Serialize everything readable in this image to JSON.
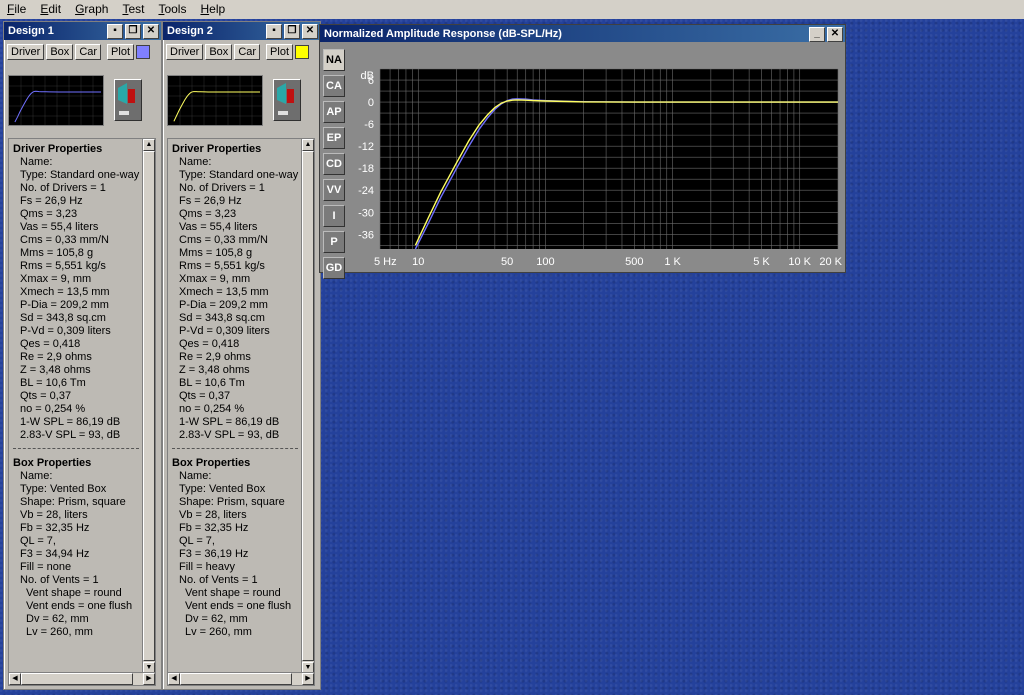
{
  "menu": [
    {
      "label": "File",
      "u": "F",
      "rest": "ile"
    },
    {
      "label": "Edit",
      "u": "E",
      "rest": "dit"
    },
    {
      "label": "Graph",
      "u": "G",
      "rest": "raph"
    },
    {
      "label": "Test",
      "u": "T",
      "rest": "est"
    },
    {
      "label": "Tools",
      "u": "T",
      "rest": "ools"
    },
    {
      "label": "Help",
      "u": "H",
      "rest": "elp"
    }
  ],
  "designs": [
    {
      "title": "Design 1",
      "buttons": {
        "driver": "Driver",
        "box": "Box",
        "car": "Car",
        "plot": "Plot"
      },
      "swatch": "#8080ff",
      "curve_color": "#7070ff",
      "driver_heading": "Driver Properties",
      "driver_lines": [
        "Name:",
        "Type: Standard one-way d",
        "No. of Drivers = 1",
        "Fs = 26,9 Hz",
        "Qms = 3,23",
        "Vas = 55,4 liters",
        "Cms = 0,33 mm/N",
        "Mms = 105,8 g",
        "Rms = 5,551 kg/s",
        "Xmax = 9, mm",
        "Xmech = 13,5 mm",
        "P-Dia = 209,2 mm",
        "Sd = 343,8 sq.cm",
        "P-Vd = 0,309 liters",
        "Qes = 0,418",
        "Re = 2,9 ohms",
        "Z = 3,48 ohms",
        "BL = 10,6 Tm",
        "Qts = 0,37",
        "no = 0,254 %",
        "1-W SPL = 86,19 dB",
        "2.83-V SPL = 93, dB"
      ],
      "box_heading": "Box Properties",
      "box_lines": [
        "Name:",
        "Type: Vented Box",
        "Shape: Prism, square",
        "Vb = 28, liters",
        "Fb = 32,35 Hz",
        "QL = 7,",
        "F3 = 34,94 Hz",
        "Fill = none",
        "No. of Vents = 1"
      ],
      "vent_lines": [
        "Vent shape = round",
        "Vent ends = one flush",
        "Dv = 62, mm",
        "Lv = 260, mm"
      ]
    },
    {
      "title": "Design 2",
      "buttons": {
        "driver": "Driver",
        "box": "Box",
        "car": "Car",
        "plot": "Plot"
      },
      "swatch": "#ffff00",
      "curve_color": "#ffff60",
      "driver_heading": "Driver Properties",
      "driver_lines": [
        "Name:",
        "Type: Standard one-way d",
        "No. of Drivers = 1",
        "Fs = 26,9 Hz",
        "Qms = 3,23",
        "Vas = 55,4 liters",
        "Cms = 0,33 mm/N",
        "Mms = 105,8 g",
        "Rms = 5,551 kg/s",
        "Xmax = 9, mm",
        "Xmech = 13,5 mm",
        "P-Dia = 209,2 mm",
        "Sd = 343,8 sq.cm",
        "P-Vd = 0,309 liters",
        "Qes = 0,418",
        "Re = 2,9 ohms",
        "Z = 3,48 ohms",
        "BL = 10,6 Tm",
        "Qts = 0,37",
        "no = 0,254 %",
        "1-W SPL = 86,19 dB",
        "2.83-V SPL = 93, dB"
      ],
      "box_heading": "Box Properties",
      "box_lines": [
        "Name:",
        "Type: Vented Box",
        "Shape: Prism, square",
        "Vb = 28, liters",
        "Fb = 32,35 Hz",
        "QL = 7,",
        "F3 = 36,19 Hz",
        "Fill = heavy",
        "No. of Vents = 1"
      ],
      "vent_lines": [
        "Vent shape = round",
        "Vent ends = one flush",
        "Dv = 62, mm",
        "Lv = 260, mm"
      ]
    }
  ],
  "graph": {
    "title": "Normalized Amplitude Response (dB-SPL/Hz)",
    "tabs": [
      "NA",
      "CA",
      "AP",
      "EP",
      "CD",
      "VV",
      "I",
      "P",
      "GD"
    ],
    "active_tab": "NA"
  },
  "chart_data": {
    "type": "line",
    "title": "Normalized Amplitude Response (dB-SPL/Hz)",
    "ylabel": "dB",
    "xscale": "log",
    "xlim": [
      5,
      20000
    ],
    "ylim": [
      -40,
      9
    ],
    "yticks": [
      6,
      0,
      -6,
      -12,
      -18,
      -24,
      -30,
      -36
    ],
    "xtick_labels": [
      {
        "v": 5,
        "t": "5 Hz"
      },
      {
        "v": 10,
        "t": "10"
      },
      {
        "v": 50,
        "t": "50"
      },
      {
        "v": 100,
        "t": "100"
      },
      {
        "v": 500,
        "t": "500"
      },
      {
        "v": 1000,
        "t": "1 K"
      },
      {
        "v": 5000,
        "t": "5 K"
      },
      {
        "v": 10000,
        "t": "10 K"
      },
      {
        "v": 20000,
        "t": "20 K"
      }
    ],
    "grid": true,
    "series": [
      {
        "color": "#7070ff",
        "x": [
          9.5,
          12,
          15,
          20,
          25,
          30,
          35,
          40,
          45,
          50,
          55,
          60,
          70,
          80,
          100,
          150,
          200,
          500,
          1000,
          20000
        ],
        "y": [
          -40,
          -33,
          -26,
          -18,
          -12,
          -7.5,
          -4.3,
          -2,
          -0.5,
          0.4,
          0.8,
          0.9,
          0.8,
          0.6,
          0.4,
          0.2,
          0.1,
          0,
          0,
          0
        ]
      },
      {
        "color": "#ffff60",
        "x": [
          9.5,
          12,
          15,
          20,
          25,
          30,
          35,
          40,
          45,
          50,
          55,
          60,
          70,
          80,
          100,
          150,
          200,
          500,
          1000,
          20000
        ],
        "y": [
          -39,
          -31.5,
          -24.5,
          -16.5,
          -10.5,
          -6.3,
          -3.5,
          -1.5,
          -0.3,
          0.3,
          0.5,
          0.6,
          0.5,
          0.4,
          0.3,
          0.15,
          0.05,
          0,
          0,
          0
        ]
      }
    ]
  }
}
